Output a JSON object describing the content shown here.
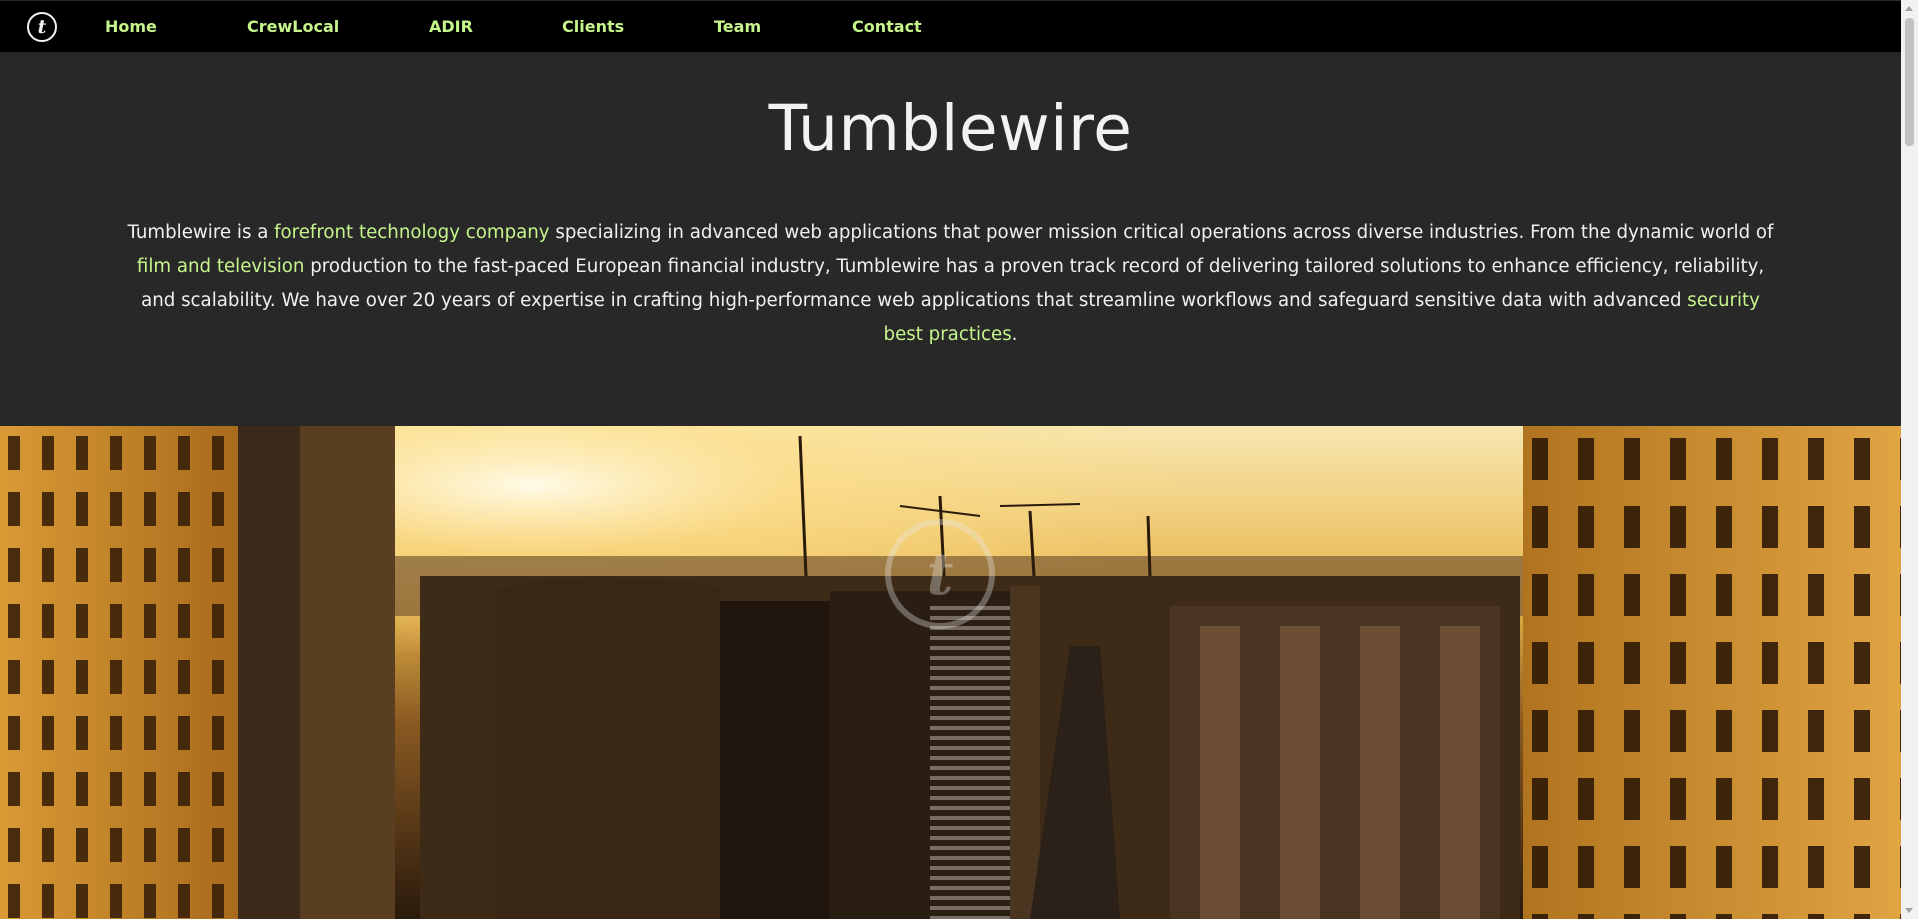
{
  "nav": {
    "logo_letter": "t",
    "items": [
      {
        "label": "Home"
      },
      {
        "label": "CrewLocal"
      },
      {
        "label": "ADIR"
      },
      {
        "label": "Clients"
      },
      {
        "label": "Team"
      },
      {
        "label": "Contact"
      }
    ]
  },
  "intro": {
    "title": "Tumblewire",
    "text_1": "Tumblewire is a ",
    "link_1": "forefront technology company",
    "text_2": " specializing in advanced web applications that power mission critical operations across diverse industries. From the dynamic world of ",
    "link_2": "film and television",
    "text_3": " production to the fast-paced European financial industry, Tumblewire has a proven track record of delivering tailored solutions to enhance efficiency, reliability, and scalability. We have over 20 years of expertise in crafting high-performance web applications that streamline workflows and safeguard sensitive data with advanced ",
    "link_3": "security best practices",
    "text_4": "."
  },
  "colors": {
    "nav_bg": "#000000",
    "intro_bg": "#282828",
    "accent": "#c6f58c",
    "text": "#f0f0f0"
  },
  "icons": {
    "logo": "tumblewire-logo-icon",
    "video_overlay": "tumblewire-watermark-icon"
  }
}
